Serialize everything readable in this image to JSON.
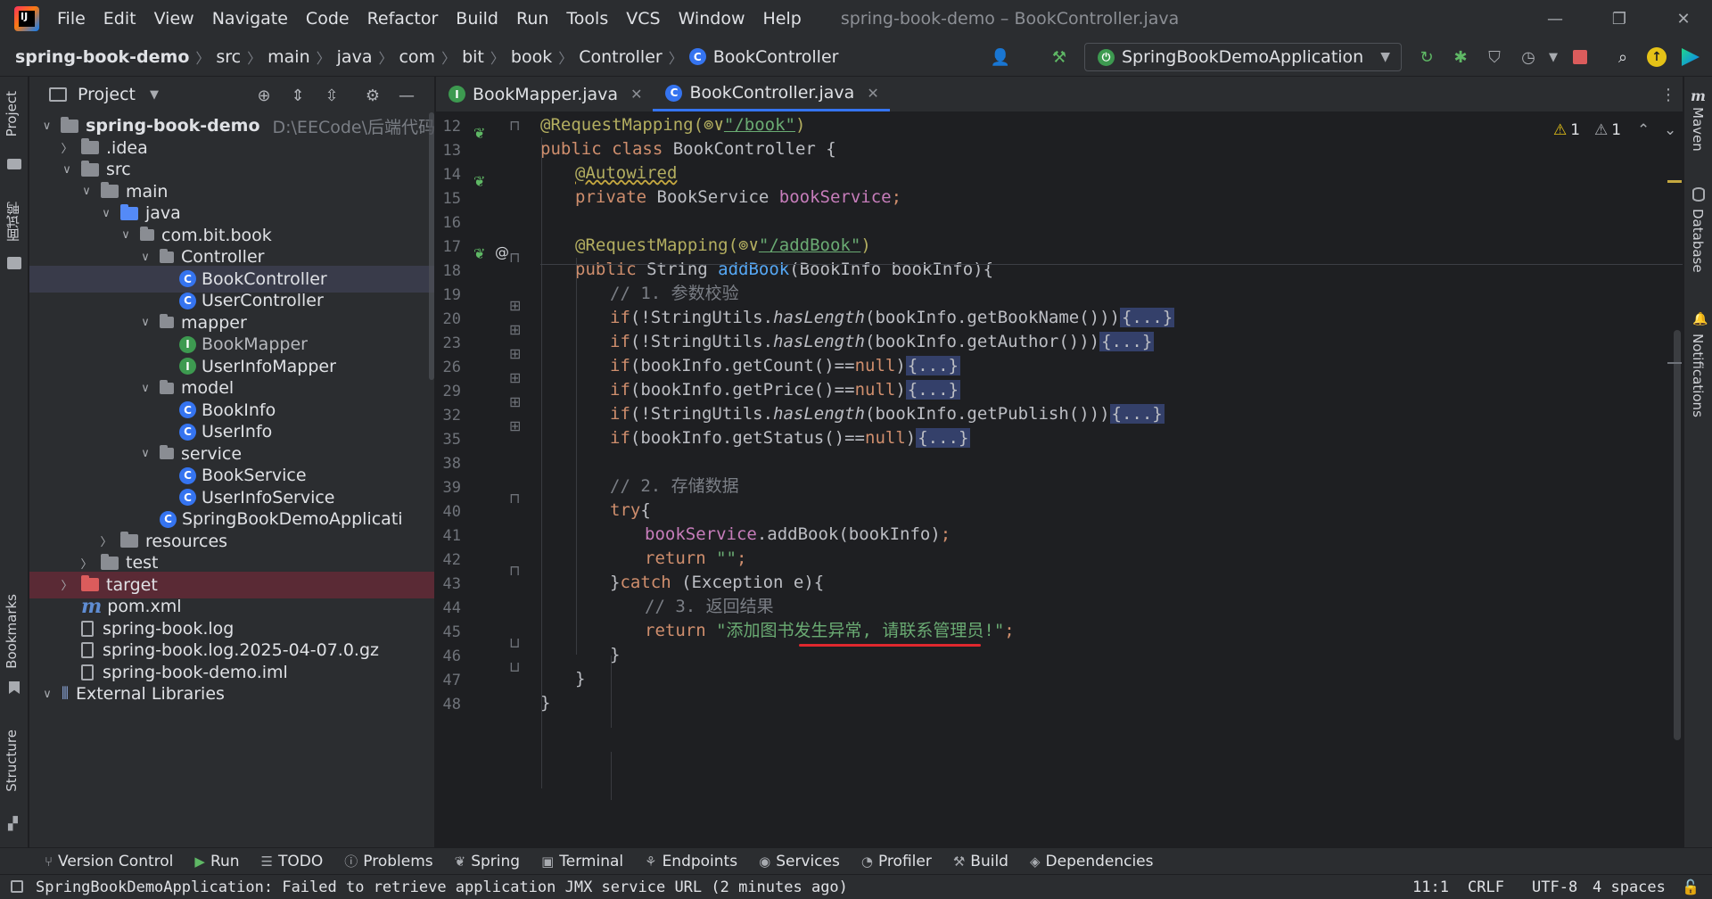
{
  "window": {
    "title": "spring-book-demo – BookController.java",
    "logo": "IJ"
  },
  "menu": [
    "File",
    "Edit",
    "View",
    "Navigate",
    "Code",
    "Refactor",
    "Build",
    "Run",
    "Tools",
    "VCS",
    "Window",
    "Help"
  ],
  "breadcrumb": [
    "spring-book-demo",
    "src",
    "main",
    "java",
    "com",
    "bit",
    "book",
    "Controller",
    "BookController"
  ],
  "toolbar": {
    "run_config": "SpringBookDemoApplication"
  },
  "left_strip": {
    "project": "Project",
    "mianshi": "面试鸭",
    "bookmarks": "Bookmarks",
    "structure": "Structure"
  },
  "right_strip": {
    "maven": "Maven",
    "database": "Database",
    "notifications": "Notifications"
  },
  "project_panel": {
    "title": "Project",
    "tree": [
      {
        "label": "spring-book-demo",
        "extra": "D:\\EECode\\后端代码",
        "depth": 0,
        "chev": "v",
        "icon": "folder",
        "bold": true
      },
      {
        "label": ".idea",
        "depth": 1,
        "chev": ">",
        "icon": "folder"
      },
      {
        "label": "src",
        "depth": 1,
        "chev": "v",
        "icon": "folder"
      },
      {
        "label": "main",
        "depth": 2,
        "chev": "v",
        "icon": "folder"
      },
      {
        "label": "java",
        "depth": 3,
        "chev": "v",
        "icon": "folder-blue"
      },
      {
        "label": "com.bit.book",
        "depth": 4,
        "chev": "v",
        "icon": "package"
      },
      {
        "label": "Controller",
        "depth": 5,
        "chev": "v",
        "icon": "package"
      },
      {
        "label": "BookController",
        "depth": 6,
        "icon": "class",
        "selected": true
      },
      {
        "label": "UserController",
        "depth": 6,
        "icon": "class"
      },
      {
        "label": "mapper",
        "depth": 5,
        "chev": "v",
        "icon": "package"
      },
      {
        "label": "BookMapper",
        "depth": 6,
        "icon": "interface",
        "dim": true
      },
      {
        "label": "UserInfoMapper",
        "depth": 6,
        "icon": "interface"
      },
      {
        "label": "model",
        "depth": 5,
        "chev": "v",
        "icon": "package"
      },
      {
        "label": "BookInfo",
        "depth": 6,
        "icon": "class"
      },
      {
        "label": "UserInfo",
        "depth": 6,
        "icon": "class"
      },
      {
        "label": "service",
        "depth": 5,
        "chev": "v",
        "icon": "package"
      },
      {
        "label": "BookService",
        "depth": 6,
        "icon": "class"
      },
      {
        "label": "UserInfoService",
        "depth": 6,
        "icon": "class"
      },
      {
        "label": "SpringBookDemoApplicati",
        "depth": 5,
        "icon": "class"
      },
      {
        "label": "resources",
        "depth": 3,
        "chev": ">",
        "icon": "folder"
      },
      {
        "label": "test",
        "depth": 2,
        "chev": ">",
        "icon": "folder"
      },
      {
        "label": "target",
        "depth": 1,
        "chev": ">",
        "icon": "folder-red",
        "target": true
      },
      {
        "label": "pom.xml",
        "depth": 1,
        "icon": "maven"
      },
      {
        "label": "spring-book.log",
        "depth": 1,
        "icon": "file"
      },
      {
        "label": "spring-book.log.2025-04-07.0.gz",
        "depth": 1,
        "icon": "file"
      },
      {
        "label": "spring-book-demo.iml",
        "depth": 1,
        "icon": "file"
      },
      {
        "label": "External Libraries",
        "depth": 0,
        "chev": "v",
        "icon": "libs"
      }
    ]
  },
  "tabs": [
    {
      "label": "BookMapper.java",
      "icon": "I",
      "active": false
    },
    {
      "label": "BookController.java",
      "icon": "C",
      "active": true
    }
  ],
  "editor": {
    "warnings": "1",
    "weak_warnings": "1",
    "lines": [
      {
        "n": "12",
        "tokens": [
          [
            "ann",
            "@RequestMapping("
          ],
          [
            "ann",
            "⊚∨"
          ],
          [
            "link",
            "\"/book\""
          ],
          [
            "ann",
            ")"
          ]
        ]
      },
      {
        "n": "13",
        "tokens": [
          [
            "kw",
            "public class "
          ],
          [
            "",
            "BookController {"
          ]
        ]
      },
      {
        "n": "14",
        "indent": 1,
        "tokens": [
          [
            "ann wave",
            "@Autowired"
          ]
        ]
      },
      {
        "n": "15",
        "indent": 1,
        "tokens": [
          [
            "kw",
            "private "
          ],
          [
            "",
            "BookService "
          ],
          [
            "field",
            "bookService"
          ],
          [
            "kw",
            ";"
          ]
        ]
      },
      {
        "n": "16",
        "tokens": []
      },
      {
        "n": "17",
        "indent": 1,
        "tokens": [
          [
            "ann",
            "@RequestMapping("
          ],
          [
            "ann",
            "⊚∨"
          ],
          [
            "link",
            "\"/addBook\""
          ],
          [
            "ann",
            ")"
          ]
        ]
      },
      {
        "n": "18",
        "indent": 1,
        "tokens": [
          [
            "kw",
            "public "
          ],
          [
            "",
            "String "
          ],
          [
            "fn",
            "addBook"
          ],
          [
            "",
            "(BookInfo bookInfo){"
          ]
        ]
      },
      {
        "n": "19",
        "indent": 2,
        "tokens": [
          [
            "cmt",
            "// 1. 参数校验"
          ]
        ]
      },
      {
        "n": "20",
        "indent": 2,
        "tokens": [
          [
            "kw",
            "if"
          ],
          [
            "",
            "(!StringUtils."
          ],
          [
            "italic",
            "hasLength"
          ],
          [
            "",
            "(bookInfo.getBookName()))"
          ],
          [
            "fold",
            "{...}"
          ]
        ]
      },
      {
        "n": "23",
        "indent": 2,
        "tokens": [
          [
            "kw",
            "if"
          ],
          [
            "",
            "(!StringUtils."
          ],
          [
            "italic",
            "hasLength"
          ],
          [
            "",
            "(bookInfo.getAuthor()))"
          ],
          [
            "fold",
            "{...}"
          ]
        ]
      },
      {
        "n": "26",
        "indent": 2,
        "tokens": [
          [
            "kw",
            "if"
          ],
          [
            "",
            "(bookInfo.getCount()=="
          ],
          [
            "kw",
            "null"
          ],
          [
            "",
            ")"
          ],
          [
            "fold",
            "{...}"
          ]
        ]
      },
      {
        "n": "29",
        "indent": 2,
        "tokens": [
          [
            "kw",
            "if"
          ],
          [
            "",
            "(bookInfo.getPrice()=="
          ],
          [
            "kw",
            "null"
          ],
          [
            "",
            ")"
          ],
          [
            "fold",
            "{...}"
          ]
        ]
      },
      {
        "n": "32",
        "indent": 2,
        "tokens": [
          [
            "kw",
            "if"
          ],
          [
            "",
            "(!StringUtils."
          ],
          [
            "italic",
            "hasLength"
          ],
          [
            "",
            "(bookInfo.getPublish()))"
          ],
          [
            "fold",
            "{...}"
          ]
        ]
      },
      {
        "n": "35",
        "indent": 2,
        "tokens": [
          [
            "kw",
            "if"
          ],
          [
            "",
            "(bookInfo.getStatus()=="
          ],
          [
            "kw",
            "null"
          ],
          [
            "",
            ")"
          ],
          [
            "fold",
            "{...}"
          ]
        ]
      },
      {
        "n": "38",
        "tokens": []
      },
      {
        "n": "39",
        "indent": 2,
        "tokens": [
          [
            "cmt",
            "// 2. 存储数据"
          ]
        ]
      },
      {
        "n": "40",
        "indent": 2,
        "tokens": [
          [
            "kw",
            "try"
          ],
          [
            "",
            "{"
          ]
        ]
      },
      {
        "n": "41",
        "indent": 3,
        "tokens": [
          [
            "field",
            "bookService"
          ],
          [
            "",
            "."
          ],
          [
            "",
            "addBook(bookInfo)"
          ],
          [
            "kw",
            ";"
          ]
        ]
      },
      {
        "n": "42",
        "indent": 3,
        "tokens": [
          [
            "kw",
            "return "
          ],
          [
            "str",
            "\"\""
          ],
          [
            "kw",
            ";"
          ]
        ]
      },
      {
        "n": "43",
        "indent": 2,
        "tokens": [
          [
            "",
            "}"
          ],
          [
            "kw",
            "catch "
          ],
          [
            "",
            "(Exception e){"
          ]
        ]
      },
      {
        "n": "44",
        "indent": 3,
        "tokens": [
          [
            "cmt",
            "// 3. 返回结果"
          ]
        ]
      },
      {
        "n": "45",
        "indent": 3,
        "tokens": [
          [
            "kw",
            "return "
          ],
          [
            "str",
            "\"添加图书发生异常, 请联系管理员!\""
          ],
          [
            "kw",
            ";"
          ]
        ]
      },
      {
        "n": "46",
        "indent": 2,
        "tokens": [
          [
            "",
            "}"
          ]
        ]
      },
      {
        "n": "47",
        "indent": 1,
        "tokens": [
          [
            "",
            "}"
          ]
        ]
      },
      {
        "n": "48",
        "tokens": [
          [
            "",
            "}"
          ]
        ]
      }
    ]
  },
  "bottom_tools": [
    {
      "label": "Version Control",
      "icon": "⑂"
    },
    {
      "label": "Run",
      "icon": "▶"
    },
    {
      "label": "TODO",
      "icon": "☰"
    },
    {
      "label": "Problems",
      "icon": "ⓘ"
    },
    {
      "label": "Spring",
      "icon": "❦"
    },
    {
      "label": "Terminal",
      "icon": "▣"
    },
    {
      "label": "Endpoints",
      "icon": "⚘"
    },
    {
      "label": "Services",
      "icon": "◉"
    },
    {
      "label": "Profiler",
      "icon": "◔"
    },
    {
      "label": "Build",
      "icon": "⚒"
    },
    {
      "label": "Dependencies",
      "icon": "◈"
    }
  ],
  "status": {
    "message": "SpringBookDemoApplication: Failed to retrieve application JMX service URL (2 minutes ago)",
    "position": "11:1",
    "line_sep": "CRLF",
    "encoding": "UTF-8",
    "indent": "4 spaces"
  }
}
